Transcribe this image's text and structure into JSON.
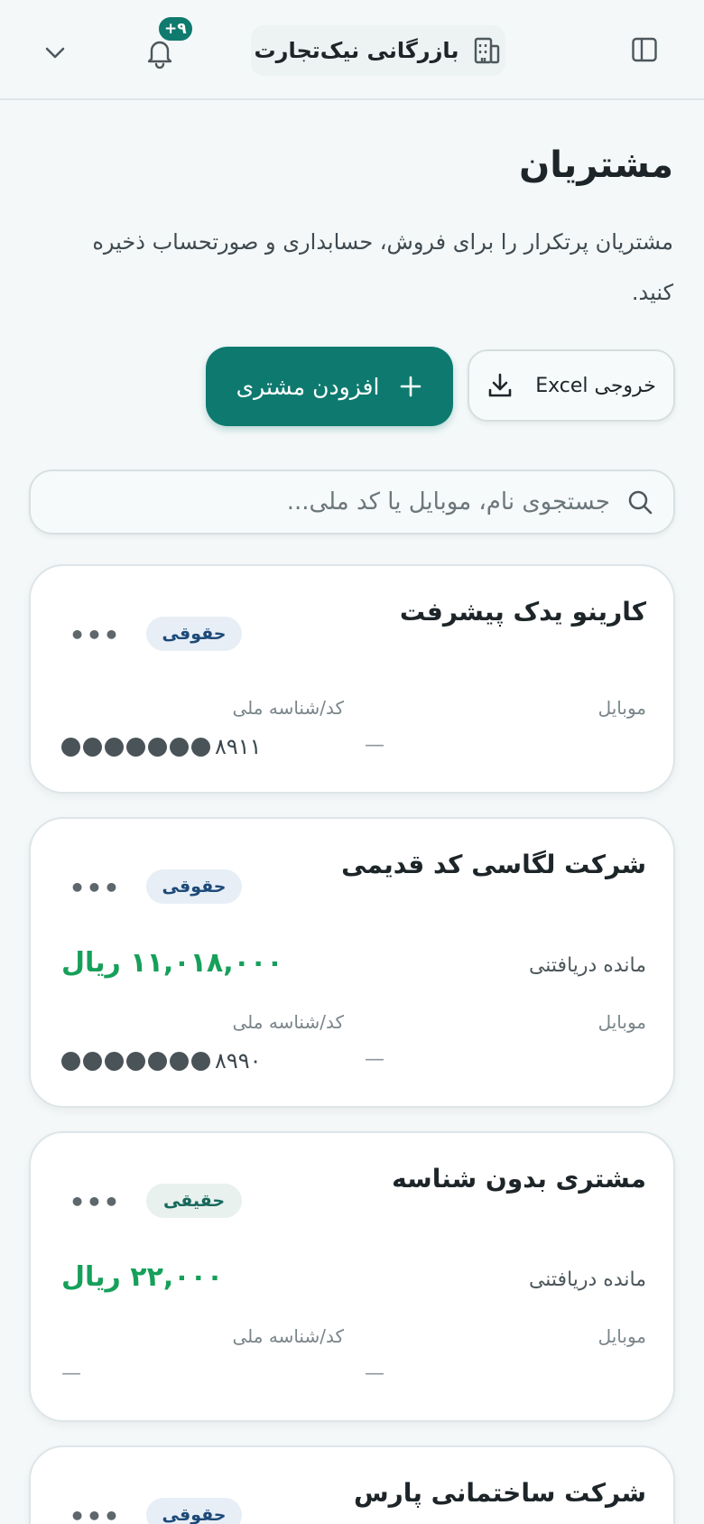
{
  "topbar": {
    "notification_count": "۹+",
    "company_name": "بازرگانی نیک‌تجارت"
  },
  "page": {
    "title": "مشتریان",
    "description": "مشتریان پرتکرار را برای فروش، حسابداری و صورتحساب ذخیره کنید."
  },
  "actions": {
    "add_label": "افزودن مشتری",
    "excel_label": "خروجی Excel"
  },
  "search": {
    "placeholder": "جستجوی نام، موبایل یا کد ملی..."
  },
  "labels": {
    "mobile": "موبایل",
    "national_id": "کد/شناسه ملی",
    "balance": "مانده دریافتنی",
    "menu": "•••",
    "empty": "—"
  },
  "customers": [
    {
      "name": "کارینو یدک پیشرفت",
      "type": "حقوقی",
      "mobile": "—",
      "national_id_suffix": "۸۹۱۱",
      "masked_dots": 7
    },
    {
      "name": "شرکت لگاسی کد قدیمی",
      "type": "حقوقی",
      "balance": "۱۱,۰۱۸,۰۰۰ ریال",
      "mobile": "—",
      "national_id_suffix": "۸۹۹۰",
      "masked_dots": 7
    },
    {
      "name": "مشتری بدون شناسه",
      "type": "حقیقی",
      "balance": "۲۲,۰۰۰ ریال",
      "mobile": "—",
      "national_id": "—"
    },
    {
      "name": "شرکت ساختمانی پارس",
      "type": "حقوقی"
    }
  ],
  "colors": {
    "primary": "#0e7a6f",
    "balance_green": "#16a05a",
    "legal_badge_bg": "#e7eef6",
    "legal_badge_text": "#1d4a78",
    "real_badge_bg": "#e8f1ee",
    "real_badge_text": "#17695c"
  }
}
